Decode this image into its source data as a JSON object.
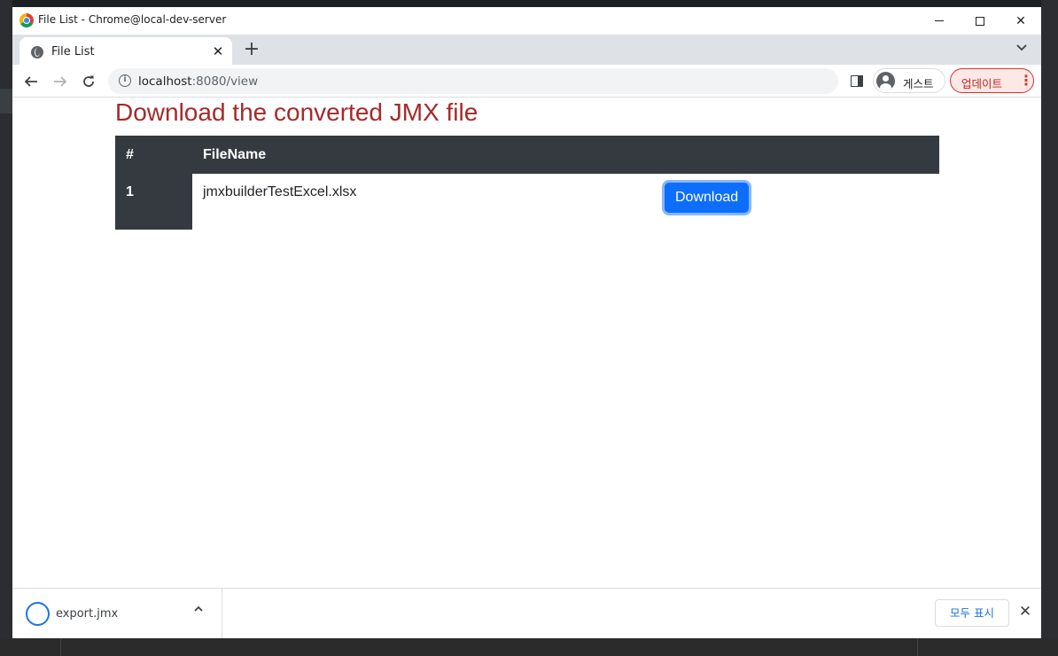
{
  "window": {
    "title": "File List - Chrome@local-dev-server"
  },
  "tab": {
    "title": "File List",
    "close": "✕",
    "new_tab": "+"
  },
  "toolbar": {
    "url_host": "localhost",
    "url_path": ":8080/view",
    "profile_label": "게스트",
    "update_label": "업데이트"
  },
  "page": {
    "title": "Download the converted JMX file",
    "table": {
      "headers": [
        "#",
        "FileName"
      ],
      "rows": [
        {
          "num": "1",
          "filename": "jmxbuilderTestExcel.xlsx",
          "action": "Download"
        }
      ]
    }
  },
  "download_bar": {
    "file": "export.jmx",
    "show_all": "모두 표시"
  },
  "colors": {
    "title": "#a52a2a",
    "table_header": "#343a40",
    "button": "#0d6efd"
  },
  "icons": [
    "chrome-logo-icon",
    "globe-icon",
    "close-icon",
    "plus-icon",
    "chevron-down-icon",
    "back-arrow-icon",
    "forward-arrow-icon",
    "reload-icon",
    "info-icon",
    "side-panel-icon",
    "avatar-icon",
    "kebab-menu-icon",
    "download-progress-icon",
    "chevron-up-icon"
  ]
}
